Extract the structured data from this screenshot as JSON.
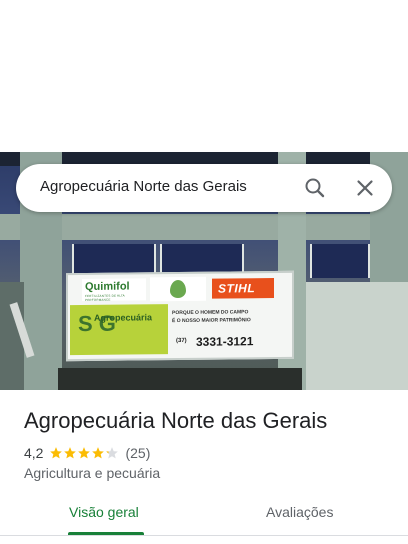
{
  "search": {
    "query": "Agropecuária Norte das Gerais",
    "search_icon": "search-icon",
    "close_icon": "close-icon"
  },
  "photo": {
    "sign": {
      "brand_left": "Quimifol",
      "brand_left_tagline": "FERTILIZANTES DE ALTA PERFORMANCE",
      "brand_right": "STIHL",
      "store_name_lines": "Agropecuária",
      "store_letters": "S G",
      "motto_line1": "PORQUE O HOMEM DO CAMPO",
      "motto_line2": "É O NOSSO MAIOR PATRIMÔNIO",
      "phone_area": "(37)",
      "phone_number": "3331-3121"
    }
  },
  "place": {
    "title": "Agropecuária Norte das Gerais",
    "rating": "4,2",
    "stars_filled_fraction": 0.84,
    "review_count": "(25)",
    "category": "Agricultura e pecuária"
  },
  "tabs": [
    {
      "label": "Visão geral",
      "active": true
    },
    {
      "label": "Avaliações",
      "active": false
    }
  ],
  "colors": {
    "accent": "#188038",
    "star": "#fbbc04",
    "star_empty": "#dadce0",
    "text_secondary": "#5f6368"
  }
}
